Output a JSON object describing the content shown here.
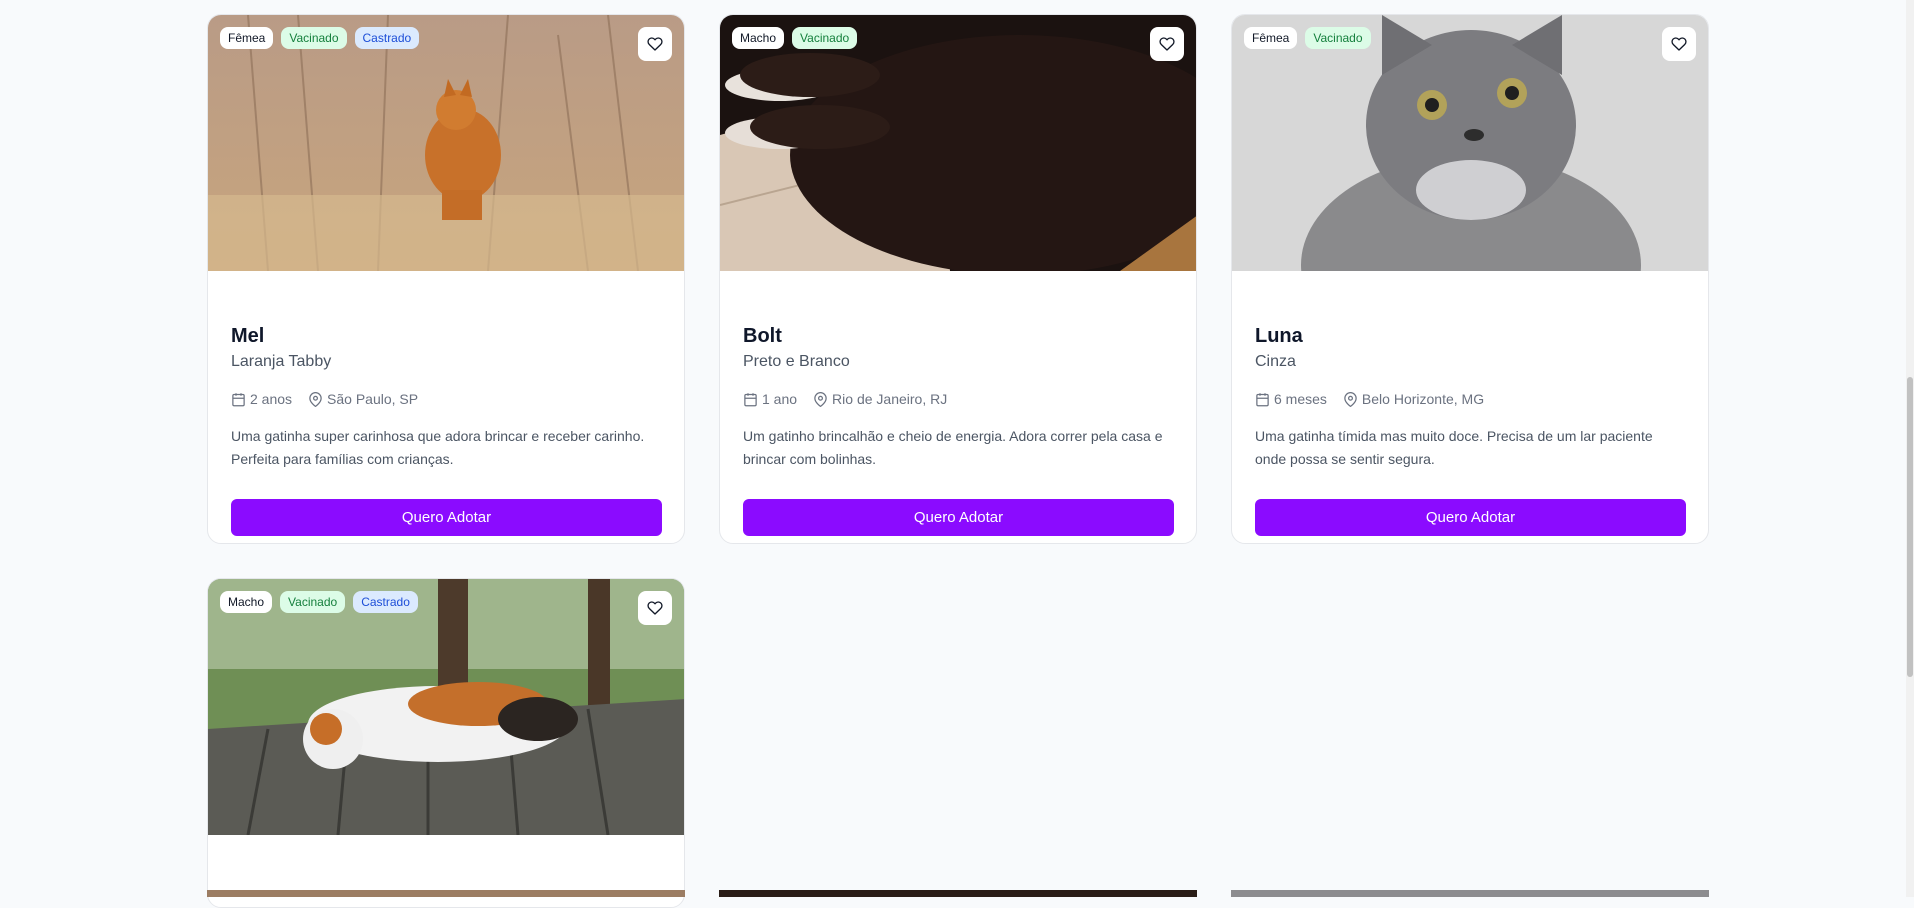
{
  "cards": [
    {
      "name": "Mel",
      "breed": "Laranja Tabby",
      "age": "2 anos",
      "location": "São Paulo, SP",
      "description": "Uma gatinha super carinhosa que adora brincar e receber carinho. Perfeita para famílias com crianças.",
      "badges": [
        "Fêmea",
        "Vacinado",
        "Castrado"
      ],
      "button": "Quero Adotar"
    },
    {
      "name": "Bolt",
      "breed": "Preto e Branco",
      "age": "1 ano",
      "location": "Rio de Janeiro, RJ",
      "description": "Um gatinho brincalhão e cheio de energia. Adora correr pela casa e brincar com bolinhas.",
      "badges": [
        "Macho",
        "Vacinado"
      ],
      "button": "Quero Adotar"
    },
    {
      "name": "Luna",
      "breed": "Cinza",
      "age": "6 meses",
      "location": "Belo Horizonte, MG",
      "description": "Uma gatinha tímida mas muito doce. Precisa de um lar paciente onde possa se sentir segura.",
      "badges": [
        "Fêmea",
        "Vacinado"
      ],
      "button": "Quero Adotar"
    },
    {
      "badges": [
        "Macho",
        "Vacinado",
        "Castrado"
      ]
    }
  ],
  "icons": {
    "favorite": "heart-icon",
    "age": "calendar-icon",
    "location": "map-pin-icon"
  },
  "colors": {
    "accent": "#8b0bff",
    "page_bg": "#f8fafc",
    "badge_green": "#dcfce7",
    "badge_blue": "#dbeafe"
  }
}
